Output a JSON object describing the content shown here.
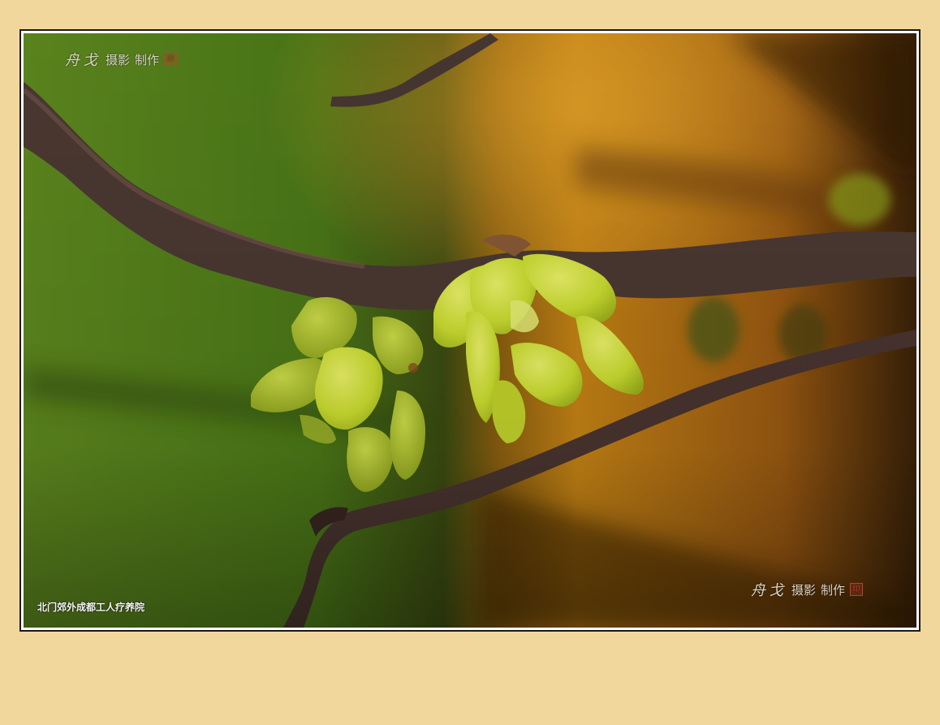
{
  "photo": {
    "caption": "北门郊外成都工人疗养院",
    "colors": {
      "background_left": "#5f8a1f",
      "background_right": "#c88515",
      "branch": "#4d3a33",
      "flower": "#d8e83a",
      "mat": "#f2d79c"
    }
  },
  "watermark": {
    "signature": "舟戈",
    "label": "摄影",
    "made": "制作",
    "seal": "印"
  }
}
